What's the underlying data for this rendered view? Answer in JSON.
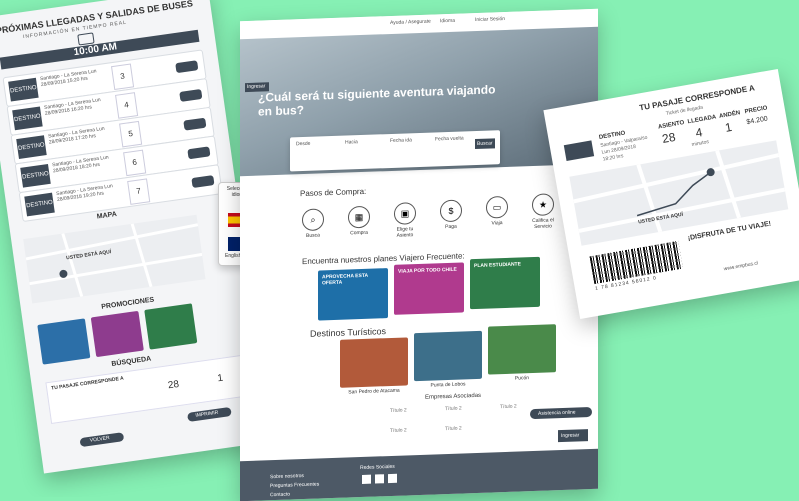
{
  "left": {
    "title": "PRÓXIMAS LLEGADAS Y SALIDAS DE BUSES",
    "subtitle": "INFORMACIÓN EN TIEMPO REAL",
    "time": "10:00 AM",
    "rows": [
      {
        "badge": "DESTINO",
        "info": "Santiago - La Serena Lun 28/09/2018 15:20 hrs",
        "num": "3"
      },
      {
        "badge": "DESTINO",
        "info": "Santiago - La Serena Lun 28/09/2018 16:20 hrs",
        "num": "4"
      },
      {
        "badge": "DESTINO",
        "info": "Santiago - La Serena Lun 28/09/2018 17:20 hrs",
        "num": "5"
      },
      {
        "badge": "DESTINO",
        "info": "Santiago - La Serena Lun 28/09/2018 18:20 hrs",
        "num": "6"
      },
      {
        "badge": "DESTINO",
        "info": "Santiago - La Serena Lun 28/09/2018 19:20 hrs",
        "num": "7"
      }
    ],
    "map_title": "MAPA",
    "map_here": "USTED ESTÁ AQUÍ",
    "promo_title": "PROMOCIONES",
    "search_title": "BÚSQUEDA",
    "ticket_title": "TU PASAJE CORRESPONDE A",
    "seat": "28",
    "platform": "1",
    "back_label": "VOLVER",
    "print_label": "IMPRIMIR",
    "lang_title": "Selecciona idioma",
    "lang_en": "English"
  },
  "center": {
    "login": "Ingresar",
    "nav_help": "Ayuda / Asegurate",
    "nav_lang": "Idioma",
    "nav_session": "Iniciar Sesión",
    "hero_title": "¿Cuál será tu siguiente aventura viajando en bus?",
    "search_labels": [
      "Desde",
      "Hacia",
      "Fecha ida",
      "Fecha vuelta"
    ],
    "search_btn": "Buscar",
    "steps_title": "Pasos de Compra:",
    "steps": [
      "Busca",
      "Compra",
      "Elige tu Asiento",
      "Paga",
      "Viaja",
      "Califica el Servicio"
    ],
    "plans_title": "Encuentra nuestros planes Viajero Frecuente:",
    "plans": [
      "APROVECHA ESTA OFERTA",
      "VIAJA POR TODO CHILE",
      "PLAN ESTUDIANTE"
    ],
    "see_more": "Ver más",
    "dest_title": "Destinos Turísticos",
    "destinations": [
      "San Pedro de Atacama",
      "Punta de Lobos",
      "Pucón"
    ],
    "companies_title": "Empresas Asociadas",
    "companies": [
      "Título 2",
      "Título 2",
      "Título 2",
      "Título 2",
      "Título 2"
    ],
    "footer_links": [
      "Sobre nosotros",
      "Preguntas Frecuentes",
      "Contacto"
    ],
    "social_title": "Redes Sociales",
    "chat": "Asistencia online"
  },
  "right": {
    "title": "TU PASAJE CORRESPONDE A",
    "subtitle": "Ticket de llegada",
    "dest_label": "DESTINO",
    "route": "Santiago - Valparaíso",
    "date": "Lun 28/09/2018",
    "time": "18:20 hrs",
    "seat_label": "ASIENTO",
    "seat": "28",
    "arrive_label": "LLEGADA",
    "arrive": "4",
    "arrive_unit": "minutos",
    "platform_label": "ANDÉN",
    "platform": "1",
    "price_label": "PRECIO",
    "price": "$4.200",
    "here": "USTED ESTÁ AQUÍ",
    "enjoy": "¡DISFRUTA DE TU VIAJE!",
    "barcode_num": "1 78 81234 56012 0",
    "site": "www.empbus.cl"
  },
  "colors": {
    "bg": "#86f0b4",
    "dark": "#3e4a57",
    "accent": "#2c7fb8"
  }
}
